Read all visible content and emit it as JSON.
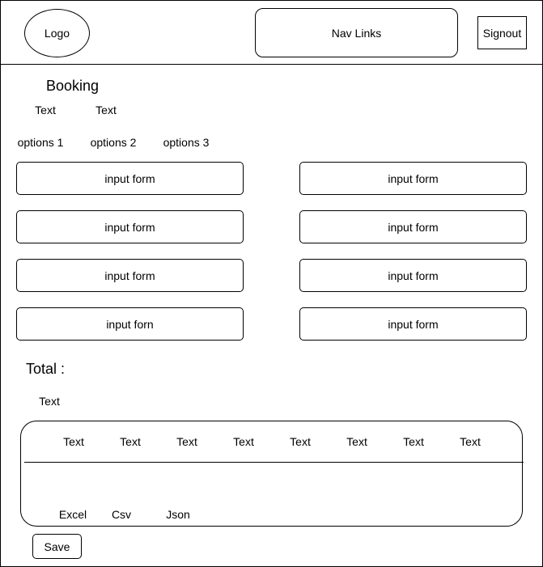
{
  "header": {
    "logo": "Logo",
    "nav_links": "Nav Links",
    "signout": "Signout"
  },
  "booking": {
    "title": "Booking",
    "texts": [
      "Text",
      "Text"
    ],
    "options": [
      "options 1",
      "options 2",
      "options 3"
    ],
    "inputs_left": [
      "input form",
      "input form",
      "input form",
      "input forn"
    ],
    "inputs_right": [
      "input form",
      "input form",
      "input form",
      "input form"
    ]
  },
  "total": {
    "label": "Total :",
    "text": "Text"
  },
  "table": {
    "headers": [
      "Text",
      "Text",
      "Text",
      "Text",
      "Text",
      "Text",
      "Text",
      "Text"
    ],
    "exports": [
      "Excel",
      "Csv",
      "Json"
    ]
  },
  "save_label": "Save"
}
